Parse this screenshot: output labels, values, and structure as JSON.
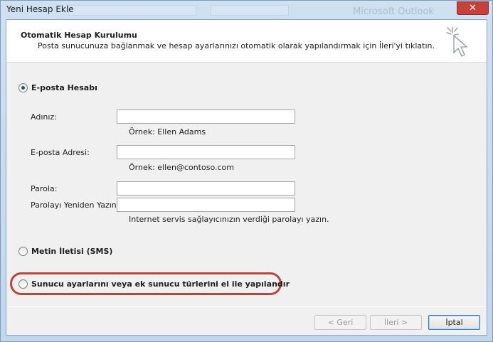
{
  "window": {
    "title": "Yeni Hesap Ekle",
    "close_glyph": "✕"
  },
  "background": {
    "ghost_text": "Microsoft Outlook"
  },
  "header": {
    "title": "Otomatik Hesap Kurulumu",
    "description": "Posta sunucunuza bağlanmak ve hesap ayarlarınızı otomatik olarak yapılandırmak için İleri'yi tıklatın."
  },
  "options": {
    "email_account": {
      "label": "E-posta Hesabı",
      "selected": true
    },
    "sms": {
      "label": "Metin İletisi (SMS)",
      "selected": false
    },
    "manual": {
      "label": "Sunucu ayarlarını veya ek sunucu türlerini el ile yapılandır",
      "selected": false
    }
  },
  "form": {
    "name": {
      "label": "Adınız:",
      "value": "",
      "hint": "Örnek: Ellen Adams"
    },
    "email": {
      "label": "E-posta Adresi:",
      "value": "",
      "hint": "Örnek: ellen@contoso.com"
    },
    "password": {
      "label": "Parola:",
      "value": ""
    },
    "password_confirm": {
      "label": "Parolayı Yeniden Yazın:",
      "value": "",
      "hint": "Internet servis sağlayıcınızın verdiği parolayı yazın."
    }
  },
  "buttons": {
    "back": "< Geri",
    "next": "İleri >",
    "cancel": "İptal"
  },
  "colors": {
    "highlight_ring": "#b8463a",
    "close_button": "#c7403a"
  }
}
